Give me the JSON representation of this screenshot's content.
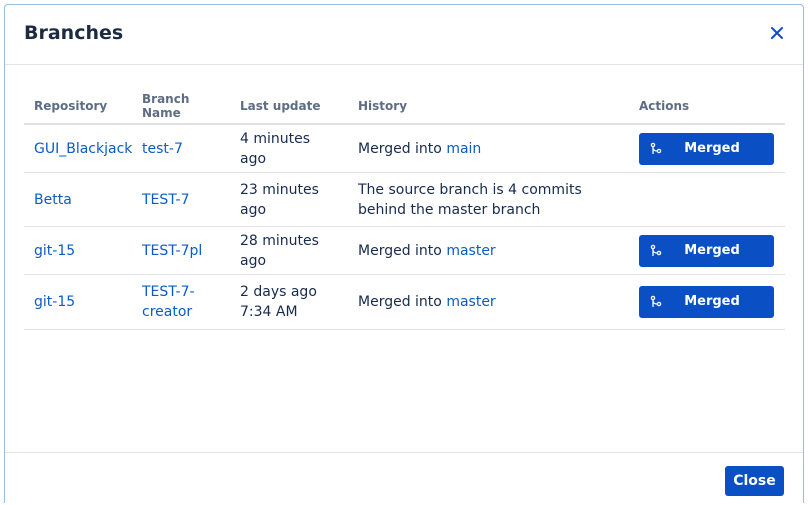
{
  "dialog": {
    "title": "Branches",
    "close_icon": "close-icon"
  },
  "table": {
    "headers": {
      "repository": "Repository",
      "branch_name": "Branch Name",
      "last_update": "Last update",
      "history": "History",
      "actions": "Actions"
    },
    "rows": [
      {
        "repository": "GUI_Blackjack",
        "branch": "test-7",
        "last_update": "4 minutes ago",
        "history_prefix": "Merged into ",
        "history_target": "main",
        "action": "Merged"
      },
      {
        "repository": "Betta",
        "branch": "TEST-7",
        "last_update": "23 minutes ago",
        "history_prefix": "The source branch is 4 commits behind the master branch",
        "history_target": "",
        "action": ""
      },
      {
        "repository": "git-15",
        "branch": "TEST-7pl",
        "last_update": "28 minutes ago",
        "history_prefix": "Merged into ",
        "history_target": "master",
        "action": "Merged"
      },
      {
        "repository": "git-15",
        "branch": "TEST-7-creator",
        "last_update": "2 days ago 7:34 AM",
        "history_prefix": "Merged into ",
        "history_target": "master",
        "action": "Merged"
      }
    ]
  },
  "footer": {
    "close_label": "Close"
  },
  "colors": {
    "accent": "#0b4fc4",
    "link": "#0b5cc4",
    "header_text": "#5e6c84"
  }
}
